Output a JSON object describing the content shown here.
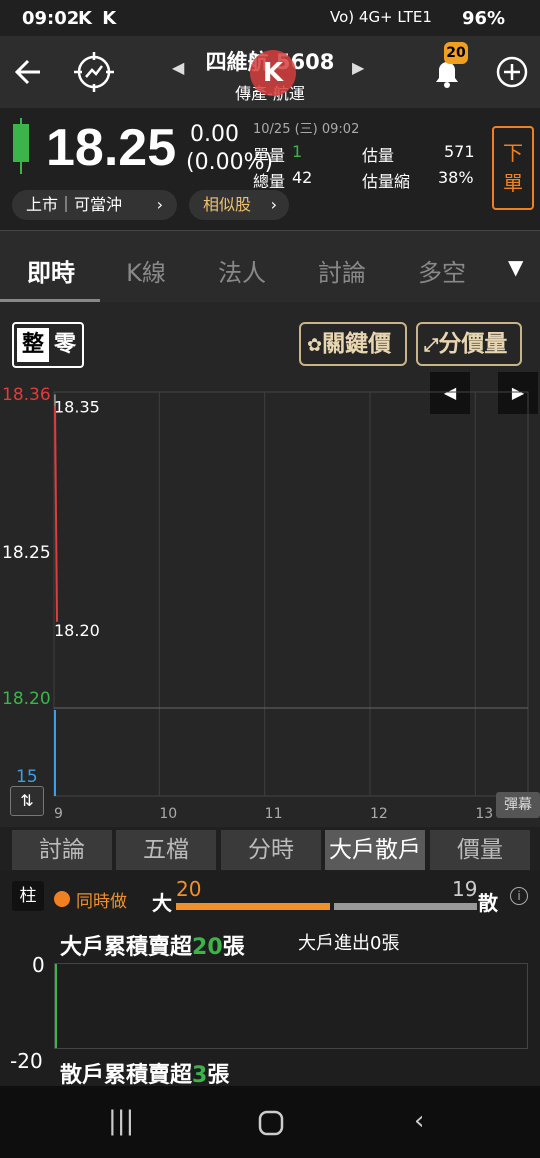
{
  "status_bar": {
    "time": "09:02",
    "left_icons": "K K",
    "right_icons": "Vo) 4G+ LTE1",
    "battery": "96%"
  },
  "header": {
    "stock_name": "四維航 5608",
    "category": "傳產-航運",
    "notification_count": "20",
    "k_overlay": "K"
  },
  "quote": {
    "price": "18.25",
    "change": "0.00",
    "change_pct": "(0.00%)",
    "datetime": "10/25 (三) 09:02",
    "single_vol_label": "單量",
    "single_vol": "1",
    "total_vol_label": "總量",
    "total_vol": "42",
    "est_vol_label": "估量",
    "est_vol": "571",
    "est_shrink_label": "估量縮",
    "est_shrink": "38%",
    "order_label": "下單",
    "market_pill": "上市｜可當沖",
    "similar_pill": "相似股"
  },
  "tabs": [
    "即時",
    "K線",
    "法人",
    "討論",
    "多空"
  ],
  "chart_tools": {
    "odd_a": "整",
    "odd_b": "零",
    "key_price": "關鍵價",
    "vol_price": "分價量",
    "danmaku": "彈幕"
  },
  "chart_data": {
    "type": "line",
    "y_ticks": [
      "18.36",
      "18.25",
      "18.20"
    ],
    "volume_tick": "15",
    "x": [
      "9",
      "10",
      "11",
      "12",
      "13"
    ],
    "annotations": [
      "18.35",
      "18.20"
    ],
    "series": [
      {
        "values": [
          18.35,
          18.2
        ]
      }
    ],
    "ylim": [
      18.14,
      18.36
    ],
    "colors": {
      "up": "#e23b3b",
      "down": "#3bb54a",
      "volume": "#3a9ee8"
    }
  },
  "subtabs": [
    "討論",
    "五檔",
    "分時",
    "大戶散戶",
    "價量"
  ],
  "panel": {
    "pillar": "柱",
    "concurrent": "同時做",
    "big_label": "大",
    "big_val": "20",
    "small_val": "19",
    "small_label": "散",
    "big_title_pre": "大戶累積賣超",
    "big_title_num": "20",
    "big_title_post": "張",
    "big_io": "大戶進出0張",
    "axis_top": "0",
    "axis_bottom": "-20",
    "small_title_pre": "散戶累積賣超",
    "small_title_num": "3",
    "small_title_post": "張"
  }
}
